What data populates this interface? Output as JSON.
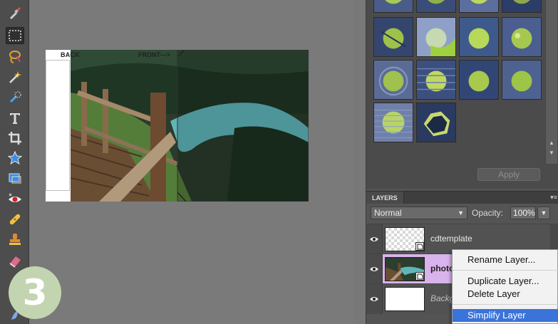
{
  "step_number": "3",
  "canvas": {
    "back_label": "BACK",
    "front_label": "FRONT--->"
  },
  "toolbar": {
    "tools": [
      "eyedropper-icon",
      "marquee-icon",
      "lasso-icon",
      "magic-wand-icon",
      "quick-selection-icon",
      "type-icon",
      "crop-icon",
      "cookie-cutter-icon",
      "recompose-icon",
      "red-eye-icon",
      "healing-brush-icon",
      "clone-stamp-icon",
      "eraser-icon",
      "smudge-icon"
    ]
  },
  "effects_panel": {
    "apply_label": "Apply"
  },
  "layers_panel": {
    "tab_label": "LAYERS",
    "blend_mode": "Normal",
    "opacity_label": "Opacity:",
    "opacity_value": "100%",
    "layers": [
      {
        "name": "cdtemplate",
        "type": "smart-object"
      },
      {
        "name": "photo",
        "type": "smart-object",
        "selected": true
      },
      {
        "name": "Backg",
        "type": "background"
      }
    ]
  },
  "context_menu": {
    "items": [
      "Rename Layer...",
      "Duplicate Layer...",
      "Delete Layer",
      "Simplify Layer"
    ],
    "highlighted": "Simplify Layer",
    "highlight_color": "#3a73d9"
  }
}
